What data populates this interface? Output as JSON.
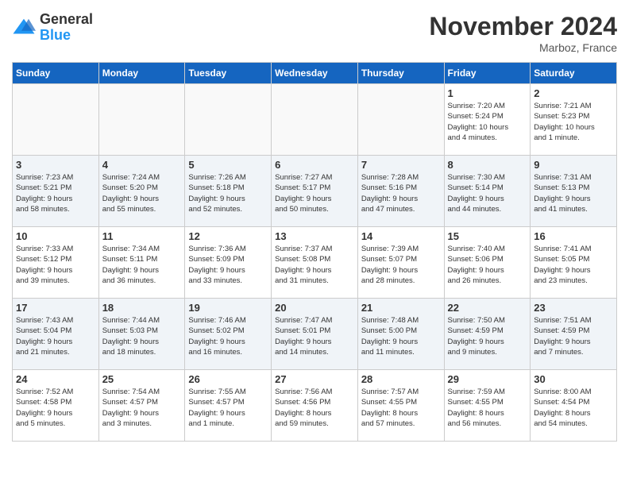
{
  "header": {
    "logo_general": "General",
    "logo_blue": "Blue",
    "month_title": "November 2024",
    "location": "Marboz, France"
  },
  "weekdays": [
    "Sunday",
    "Monday",
    "Tuesday",
    "Wednesday",
    "Thursday",
    "Friday",
    "Saturday"
  ],
  "weeks": [
    [
      {
        "day": "",
        "info": ""
      },
      {
        "day": "",
        "info": ""
      },
      {
        "day": "",
        "info": ""
      },
      {
        "day": "",
        "info": ""
      },
      {
        "day": "",
        "info": ""
      },
      {
        "day": "1",
        "info": "Sunrise: 7:20 AM\nSunset: 5:24 PM\nDaylight: 10 hours\nand 4 minutes."
      },
      {
        "day": "2",
        "info": "Sunrise: 7:21 AM\nSunset: 5:23 PM\nDaylight: 10 hours\nand 1 minute."
      }
    ],
    [
      {
        "day": "3",
        "info": "Sunrise: 7:23 AM\nSunset: 5:21 PM\nDaylight: 9 hours\nand 58 minutes."
      },
      {
        "day": "4",
        "info": "Sunrise: 7:24 AM\nSunset: 5:20 PM\nDaylight: 9 hours\nand 55 minutes."
      },
      {
        "day": "5",
        "info": "Sunrise: 7:26 AM\nSunset: 5:18 PM\nDaylight: 9 hours\nand 52 minutes."
      },
      {
        "day": "6",
        "info": "Sunrise: 7:27 AM\nSunset: 5:17 PM\nDaylight: 9 hours\nand 50 minutes."
      },
      {
        "day": "7",
        "info": "Sunrise: 7:28 AM\nSunset: 5:16 PM\nDaylight: 9 hours\nand 47 minutes."
      },
      {
        "day": "8",
        "info": "Sunrise: 7:30 AM\nSunset: 5:14 PM\nDaylight: 9 hours\nand 44 minutes."
      },
      {
        "day": "9",
        "info": "Sunrise: 7:31 AM\nSunset: 5:13 PM\nDaylight: 9 hours\nand 41 minutes."
      }
    ],
    [
      {
        "day": "10",
        "info": "Sunrise: 7:33 AM\nSunset: 5:12 PM\nDaylight: 9 hours\nand 39 minutes."
      },
      {
        "day": "11",
        "info": "Sunrise: 7:34 AM\nSunset: 5:11 PM\nDaylight: 9 hours\nand 36 minutes."
      },
      {
        "day": "12",
        "info": "Sunrise: 7:36 AM\nSunset: 5:09 PM\nDaylight: 9 hours\nand 33 minutes."
      },
      {
        "day": "13",
        "info": "Sunrise: 7:37 AM\nSunset: 5:08 PM\nDaylight: 9 hours\nand 31 minutes."
      },
      {
        "day": "14",
        "info": "Sunrise: 7:39 AM\nSunset: 5:07 PM\nDaylight: 9 hours\nand 28 minutes."
      },
      {
        "day": "15",
        "info": "Sunrise: 7:40 AM\nSunset: 5:06 PM\nDaylight: 9 hours\nand 26 minutes."
      },
      {
        "day": "16",
        "info": "Sunrise: 7:41 AM\nSunset: 5:05 PM\nDaylight: 9 hours\nand 23 minutes."
      }
    ],
    [
      {
        "day": "17",
        "info": "Sunrise: 7:43 AM\nSunset: 5:04 PM\nDaylight: 9 hours\nand 21 minutes."
      },
      {
        "day": "18",
        "info": "Sunrise: 7:44 AM\nSunset: 5:03 PM\nDaylight: 9 hours\nand 18 minutes."
      },
      {
        "day": "19",
        "info": "Sunrise: 7:46 AM\nSunset: 5:02 PM\nDaylight: 9 hours\nand 16 minutes."
      },
      {
        "day": "20",
        "info": "Sunrise: 7:47 AM\nSunset: 5:01 PM\nDaylight: 9 hours\nand 14 minutes."
      },
      {
        "day": "21",
        "info": "Sunrise: 7:48 AM\nSunset: 5:00 PM\nDaylight: 9 hours\nand 11 minutes."
      },
      {
        "day": "22",
        "info": "Sunrise: 7:50 AM\nSunset: 4:59 PM\nDaylight: 9 hours\nand 9 minutes."
      },
      {
        "day": "23",
        "info": "Sunrise: 7:51 AM\nSunset: 4:59 PM\nDaylight: 9 hours\nand 7 minutes."
      }
    ],
    [
      {
        "day": "24",
        "info": "Sunrise: 7:52 AM\nSunset: 4:58 PM\nDaylight: 9 hours\nand 5 minutes."
      },
      {
        "day": "25",
        "info": "Sunrise: 7:54 AM\nSunset: 4:57 PM\nDaylight: 9 hours\nand 3 minutes."
      },
      {
        "day": "26",
        "info": "Sunrise: 7:55 AM\nSunset: 4:57 PM\nDaylight: 9 hours\nand 1 minute."
      },
      {
        "day": "27",
        "info": "Sunrise: 7:56 AM\nSunset: 4:56 PM\nDaylight: 8 hours\nand 59 minutes."
      },
      {
        "day": "28",
        "info": "Sunrise: 7:57 AM\nSunset: 4:55 PM\nDaylight: 8 hours\nand 57 minutes."
      },
      {
        "day": "29",
        "info": "Sunrise: 7:59 AM\nSunset: 4:55 PM\nDaylight: 8 hours\nand 56 minutes."
      },
      {
        "day": "30",
        "info": "Sunrise: 8:00 AM\nSunset: 4:54 PM\nDaylight: 8 hours\nand 54 minutes."
      }
    ]
  ]
}
